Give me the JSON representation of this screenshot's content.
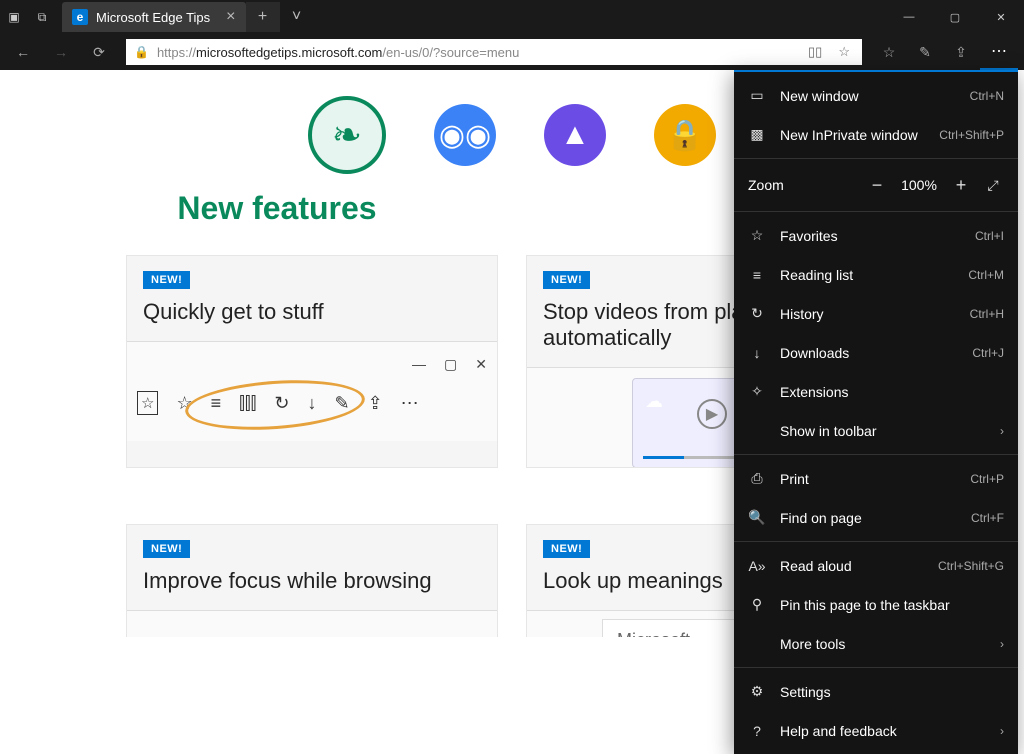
{
  "titlebar": {
    "tab_title": "Microsoft Edge Tips"
  },
  "addr": {
    "scheme": "https://",
    "host": "microsoftedgetips.microsoft.com",
    "path": "/en-us/0/?source=menu"
  },
  "hero": {
    "title": "New features"
  },
  "cards": [
    {
      "badge": "NEW!",
      "title": "Quickly get to stuff"
    },
    {
      "badge": "NEW!",
      "title": "Stop videos from playing automatically"
    },
    {
      "badge": "NEW!",
      "title": "Improve focus while browsing"
    },
    {
      "badge": "NEW!",
      "title": "Look up meanings",
      "search_text": "Microsoft"
    }
  ],
  "menu": {
    "new_window": "New window",
    "new_window_sc": "Ctrl+N",
    "inprivate": "New InPrivate window",
    "inprivate_sc": "Ctrl+Shift+P",
    "zoom": "Zoom",
    "zoom_val": "100%",
    "favorites": "Favorites",
    "favorites_sc": "Ctrl+I",
    "reading": "Reading list",
    "reading_sc": "Ctrl+M",
    "history": "History",
    "history_sc": "Ctrl+H",
    "downloads": "Downloads",
    "downloads_sc": "Ctrl+J",
    "extensions": "Extensions",
    "show_toolbar": "Show in toolbar",
    "print": "Print",
    "print_sc": "Ctrl+P",
    "find": "Find on page",
    "find_sc": "Ctrl+F",
    "read_aloud": "Read aloud",
    "read_aloud_sc": "Ctrl+Shift+G",
    "pin": "Pin this page to the taskbar",
    "more_tools": "More tools",
    "settings": "Settings",
    "help": "Help and feedback"
  }
}
